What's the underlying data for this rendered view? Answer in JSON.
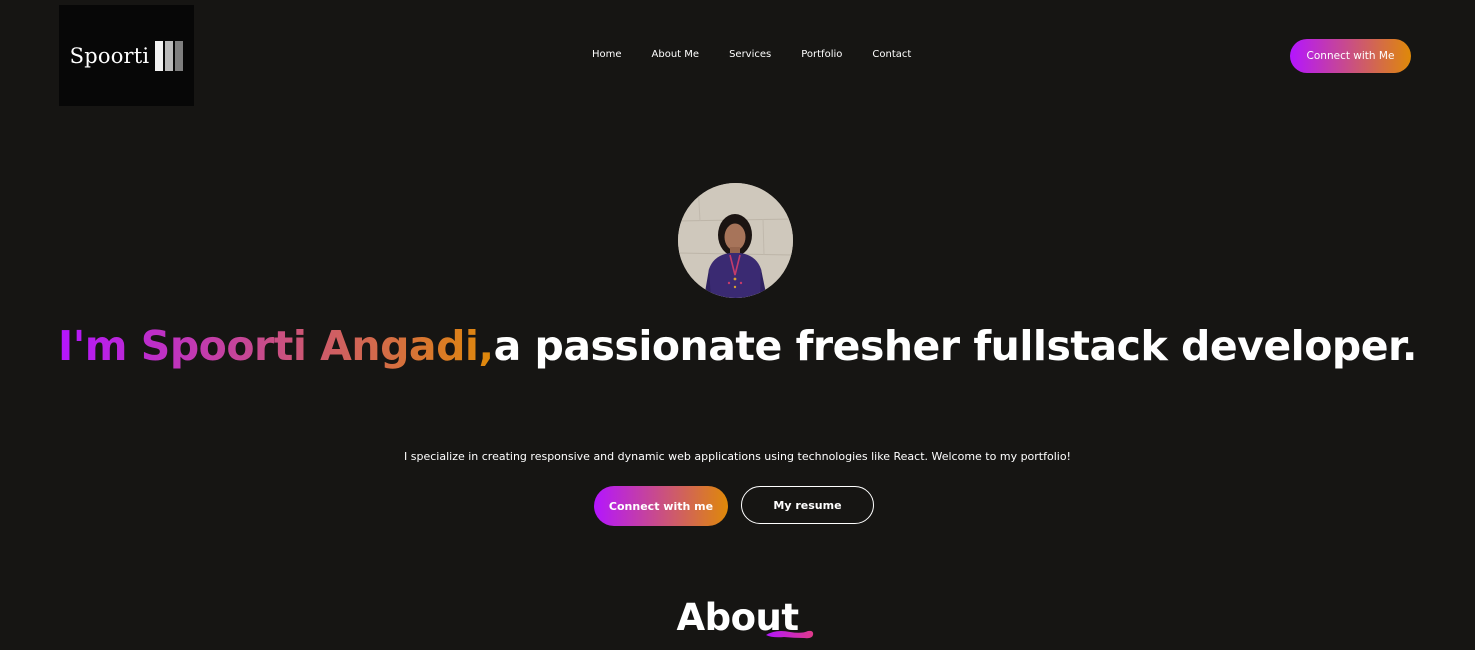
{
  "brand": {
    "logo_text": "Spoorti"
  },
  "nav": {
    "items": [
      {
        "label": "Home"
      },
      {
        "label": "About Me"
      },
      {
        "label": "Services"
      },
      {
        "label": "Portfolio"
      },
      {
        "label": "Contact"
      }
    ],
    "connect_label": "Connect with Me"
  },
  "hero": {
    "title_highlight": "I'm Spoorti Angadi,",
    "title_rest": "a passionate fresher fullstack developer.",
    "subtitle": "I specialize in creating responsive and dynamic web applications using technologies like React. Welcome to my portfolio!",
    "connect_label": "Connect with me",
    "resume_label": "My resume"
  },
  "about": {
    "heading": "About"
  },
  "colors": {
    "background": "#161513",
    "gradient_start": "#b415ff",
    "gradient_end": "#df8908"
  }
}
